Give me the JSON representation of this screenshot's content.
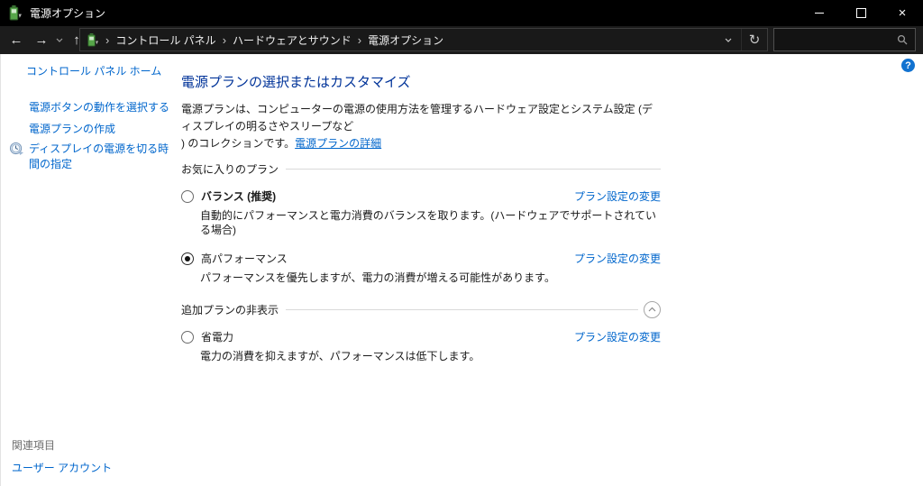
{
  "colors": {
    "titlebar_bg": "#000000",
    "toolbar_bg": "#1c1c1c",
    "content_bg": "#ffffff",
    "heading_blue": "#003399",
    "link_blue": "#0066cc",
    "help_blue": "#1172d0",
    "battery_green": "#57a64a"
  },
  "window": {
    "title": "電源オプション",
    "icon": "power-options-battery-icon",
    "controls": {
      "minimize": "最小化",
      "maximize": "最大化",
      "close": "閉じる"
    }
  },
  "toolbar": {
    "back": "←",
    "forward": "→",
    "recent": "chevron-down",
    "up": "↑",
    "breadcrumb": {
      "icon": "power-options-battery-icon",
      "separator": "›",
      "items": [
        "コントロール パネル",
        "ハードウェアとサウンド",
        "電源オプション"
      ]
    },
    "refresh": "↻",
    "search": {
      "value": "",
      "placeholder": "",
      "icon": "search-icon"
    }
  },
  "help": {
    "label": "?"
  },
  "sidebar": {
    "home": "コントロール パネル ホーム",
    "tasks": [
      {
        "label": "電源ボタンの動作を選択する"
      },
      {
        "label": "電源プランの作成"
      },
      {
        "label": "ディスプレイの電源を切る時間の指定",
        "icon": "clock-icon"
      }
    ],
    "see_also": {
      "heading": "関連項目",
      "links": [
        "ユーザー アカウント"
      ]
    }
  },
  "main": {
    "title": "電源プランの選択またはカスタマイズ",
    "intro_line1": "電源プランは、コンピューターの電源の使用方法を管理するハードウェア設定とシステム設定 (ディスプレイの明るさやスリープなど",
    "intro_line2_prefix": ") のコレクションです。",
    "intro_link": "電源プランの詳細",
    "sections": {
      "favorite": {
        "heading": "お気に入りのプラン"
      },
      "additional": {
        "heading": "追加プランの非表示",
        "toggle_icon": "chevron-up-icon"
      }
    },
    "plans": [
      {
        "name": "バランス (推奨)",
        "selected": false,
        "desc": "自動的にパフォーマンスと電力消費のバランスを取ります。(ハードウェアでサポートされている場合)",
        "link": "プラン設定の変更"
      },
      {
        "name": "高パフォーマンス",
        "selected": true,
        "desc": "パフォーマンスを優先しますが、電力の消費が増える可能性があります。",
        "link": "プラン設定の変更"
      },
      {
        "name": "省電力",
        "selected": false,
        "desc": "電力の消費を抑えますが、パフォーマンスは低下します。",
        "link": "プラン設定の変更"
      }
    ]
  }
}
